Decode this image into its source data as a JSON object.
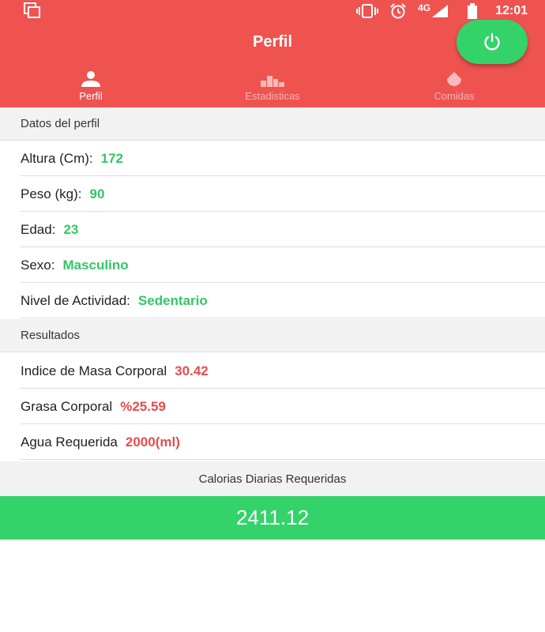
{
  "status_bar": {
    "network": "4G",
    "time": "12:01"
  },
  "header": {
    "title": "Perfil"
  },
  "tabs": [
    {
      "label": "Perfil",
      "icon": "person-icon",
      "active": true
    },
    {
      "label": "Estadisticas",
      "icon": "bar-chart-icon",
      "active": false
    },
    {
      "label": "Comidas",
      "icon": "drop-icon",
      "active": false
    }
  ],
  "profile": {
    "section_title": "Datos del perfil",
    "rows": [
      {
        "label": "Altura (Cm):",
        "value": "172"
      },
      {
        "label": "Peso (kg):",
        "value": "90"
      },
      {
        "label": "Edad:",
        "value": "23"
      },
      {
        "label": "Sexo:",
        "value": "Masculino"
      },
      {
        "label": "Nivel de Actividad:",
        "value": "Sedentario"
      }
    ]
  },
  "results": {
    "section_title": "Resultados",
    "rows": [
      {
        "label": "Indice de Masa Corporal",
        "value": "30.42"
      },
      {
        "label": "Grasa Corporal",
        "value": "%25.59"
      },
      {
        "label": "Agua Requerida",
        "value": "2000(ml)"
      }
    ]
  },
  "calories": {
    "label": "Calorias Diarias Requeridas",
    "value": "2411.12"
  },
  "colors": {
    "header": "#ef5350",
    "accent_green": "#33d36a",
    "value_green": "#33c764",
    "value_red": "#e74c4c"
  }
}
